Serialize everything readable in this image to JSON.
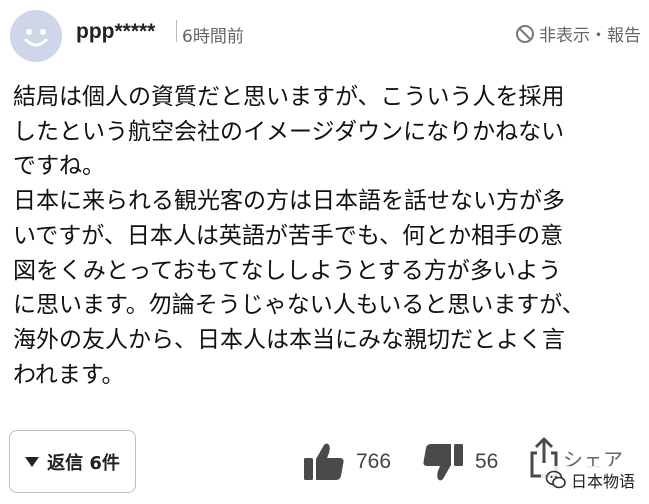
{
  "header": {
    "username": "ppp*****",
    "time": "6時間前",
    "hide_report": "非表示・報告"
  },
  "comment": {
    "lines": [
      "結局は個人の資質だと思いますが、こういう人を採用",
      "したという航空会社のイメージダウンになりかねない",
      "ですね。",
      "日本に来られる観光客の方は日本語を話せない方が多",
      "いですが、日本人は英語が苦手でも、何とか相手の意",
      "図をくみとっておもてなししようとする方が多いよう",
      "に思います。勿論そうじゃない人もいると思いますが、",
      "海外の友人から、日本人は本当にみな親切だとよく言",
      "われます。"
    ]
  },
  "footer": {
    "replies_label": "返信 6件",
    "likes": "766",
    "dislikes": "56",
    "share_label": "シェア"
  },
  "watermark": {
    "text": "日本物语"
  },
  "icons": {
    "avatar": "smiley-avatar-icon",
    "hide": "ban-icon",
    "like": "thumbs-up-icon",
    "dislike": "thumbs-down-icon",
    "share": "share-icon",
    "watermark": "wechat-icon"
  },
  "colors": {
    "avatar_bg": "#cfd6ea",
    "avatar_face": "#ffffff",
    "icon_gray": "#4a4a4a"
  }
}
